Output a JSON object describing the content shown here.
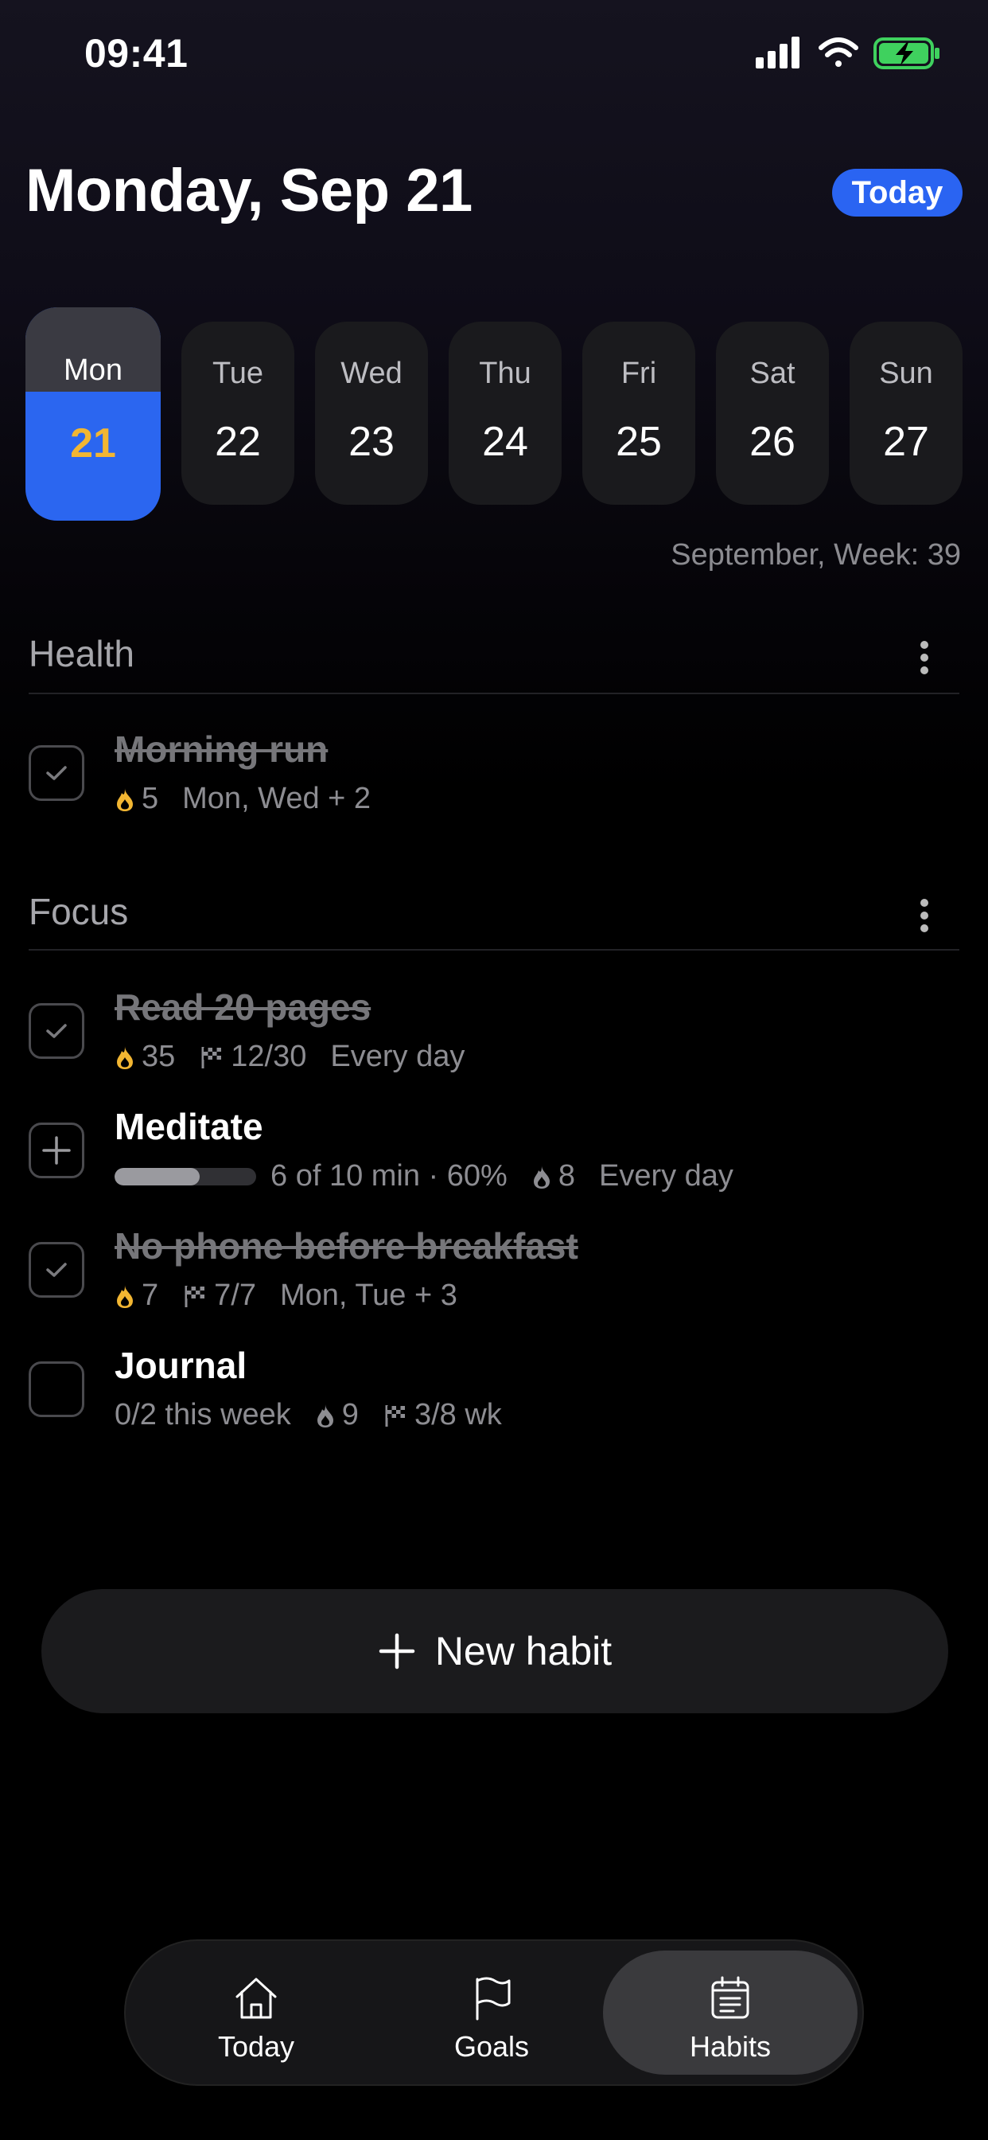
{
  "status_bar": {
    "time": "09:41"
  },
  "header": {
    "title": "Monday, Sep 21",
    "today_button": "Today"
  },
  "week": {
    "days": [
      {
        "name": "Mon",
        "num": "21",
        "selected": true
      },
      {
        "name": "Tue",
        "num": "22"
      },
      {
        "name": "Wed",
        "num": "23"
      },
      {
        "name": "Thu",
        "num": "24"
      },
      {
        "name": "Fri",
        "num": "25"
      },
      {
        "name": "Sat",
        "num": "26"
      },
      {
        "name": "Sun",
        "num": "27"
      }
    ],
    "label": "September, Week: 39"
  },
  "sections": [
    {
      "title": "Health",
      "habits": [
        {
          "title": "Morning run",
          "done": true,
          "streak": "5",
          "schedule": "Mon, Wed + 2"
        }
      ]
    },
    {
      "title": "Focus",
      "habits": [
        {
          "title": "Read 20 pages",
          "done": true,
          "streak": "35",
          "goal": "12/30",
          "schedule": "Every day"
        },
        {
          "title": "Meditate",
          "done": false,
          "progress_text": "6 of 10 min · 60%",
          "progress": 0.6,
          "streak": "8",
          "schedule": "Every day"
        },
        {
          "title": "No phone before breakfast",
          "done": true,
          "streak": "7",
          "goal": "7/7",
          "schedule": "Mon, Tue + 3"
        },
        {
          "title": "Journal",
          "done": false,
          "weekly": "0/2 this week",
          "streak": "9",
          "goal": "3/8 wk"
        }
      ]
    }
  ],
  "new_habit": {
    "label": "New habit"
  },
  "tabbar": {
    "tabs": [
      {
        "label": "Today",
        "icon": "home-icon"
      },
      {
        "label": "Goals",
        "icon": "flag-icon"
      },
      {
        "label": "Habits",
        "icon": "calendar-list-icon",
        "active": true
      }
    ]
  },
  "colors": {
    "accent": "#2a64f2",
    "streak_active": "#f2b632",
    "background": "#000000"
  }
}
